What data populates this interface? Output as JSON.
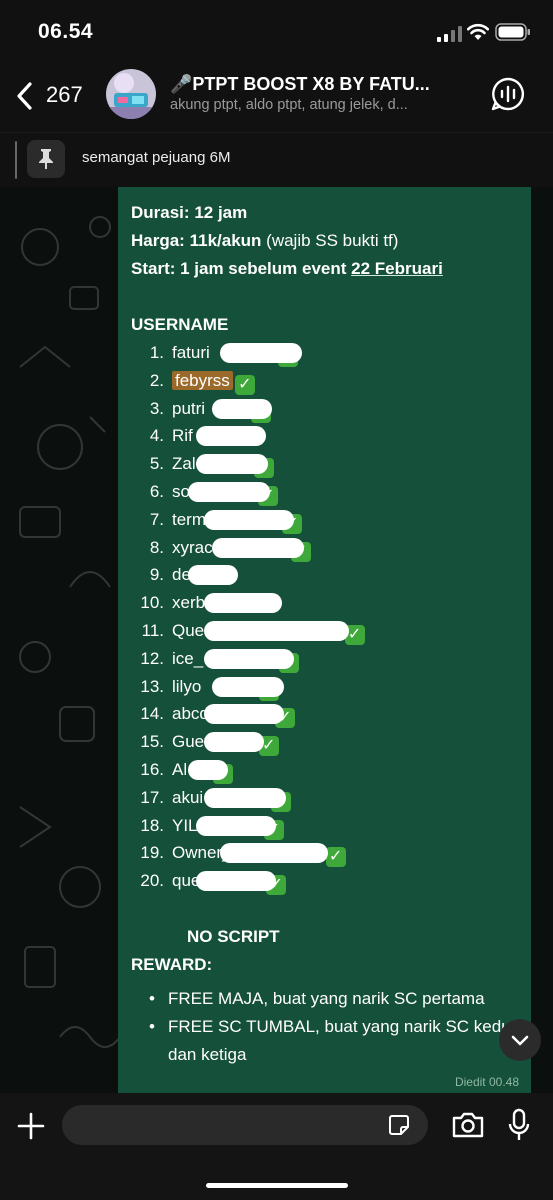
{
  "status_bar": {
    "time": "06.54"
  },
  "header": {
    "back_count": "267",
    "title": "🎤PTPT BOOST X8 BY FATU...",
    "subtitle": "akung ptpt, aldo ptpt, atung jelek, d..."
  },
  "pinned": {
    "text": "semangat pejuang 6M"
  },
  "message": {
    "duration_label": "Durasi:",
    "duration_value": "12 jam",
    "price_label": "Harga:",
    "price_value": "11k/akun",
    "price_note": "(wajib SS bukti tf)",
    "start_label": "Start: 1 jam sebelum event",
    "start_date": "22 Februari",
    "username_heading": "USERNAME",
    "usernames": [
      {
        "num": "1.",
        "name": "faturi",
        "check": true
      },
      {
        "num": "2.",
        "name": "febyrss",
        "check": true
      },
      {
        "num": "3.",
        "name": "putri",
        "check": true
      },
      {
        "num": "4.",
        "name": "Rif",
        "check": false
      },
      {
        "num": "5.",
        "name": "Zal",
        "check": true
      },
      {
        "num": "6.",
        "name": "so",
        "check": true
      },
      {
        "num": "7.",
        "name": "term",
        "check": true
      },
      {
        "num": "8.",
        "name": "xyrac",
        "check": true
      },
      {
        "num": "9.",
        "name": "de",
        "check": false
      },
      {
        "num": "10.",
        "name": "xerb",
        "check": false
      },
      {
        "num": "11.",
        "name": "Quee",
        "check": true
      },
      {
        "num": "12.",
        "name": "ice_",
        "check": true
      },
      {
        "num": "13.",
        "name": "lilyo",
        "check": true
      },
      {
        "num": "14.",
        "name": "abcd",
        "check": true
      },
      {
        "num": "15.",
        "name": "Guev",
        "check": true
      },
      {
        "num": "16.",
        "name": "Al",
        "check": true
      },
      {
        "num": "17.",
        "name": "akui",
        "check": true
      },
      {
        "num": "18.",
        "name": "YIL",
        "check": true
      },
      {
        "num": "19.",
        "name": "Owner_",
        "check": true
      },
      {
        "num": "20.",
        "name": "que",
        "check": true
      }
    ],
    "no_script": "NO SCRIPT",
    "reward_label": "REWARD:",
    "rewards": [
      "FREE MAJA, buat yang narik SC pertama",
      "FREE SC TUMBAL, buat yang narik SC kedua dan ketiga"
    ],
    "edited": "Diedit 00.48"
  },
  "colors": {
    "bubble": "#15503a",
    "check": "#3ea83a",
    "highlight": "#9b6a2a"
  }
}
